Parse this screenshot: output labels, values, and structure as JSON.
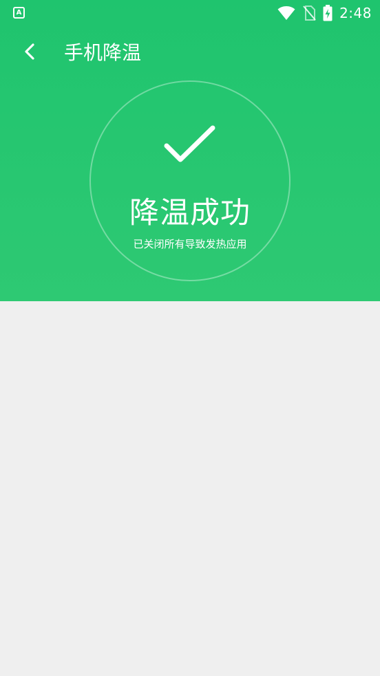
{
  "status_bar": {
    "app_icon_glyph": "A",
    "time": "2:48",
    "icons": [
      "app-notification-icon",
      "wifi-icon",
      "no-sim-icon",
      "battery-charging-icon"
    ]
  },
  "app_bar": {
    "title": "手机降温",
    "back_icon": "back-arrow-icon"
  },
  "result": {
    "icon": "checkmark-icon",
    "title": "降温成功",
    "subtitle": "已关闭所有导致发热应用"
  },
  "colors": {
    "header_green": "#1fc46e",
    "header_green_bottom": "#2ec973",
    "content_background": "#efefef",
    "foreground": "#ffffff"
  }
}
